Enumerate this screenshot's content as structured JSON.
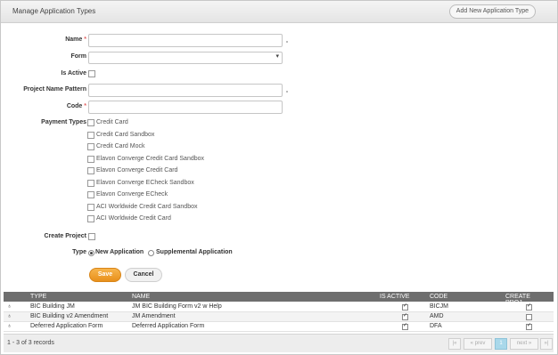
{
  "header": {
    "title": "Manage Application Types",
    "add_button": "Add New Application Type"
  },
  "form": {
    "name_label": "Name",
    "name_required": "*",
    "form_label": "Form",
    "is_active_label": "Is Active",
    "pattern_label": "Project Name Pattern",
    "code_label": "Code",
    "code_required": "*",
    "payment_types_label": "Payment Types",
    "payment_types": [
      "Credit Card",
      "Credit Card Sandbox",
      "Credit Card Mock",
      "Elavon Converge Credit Card Sandbox",
      "Elavon Converge Credit Card",
      "Elavon Converge ECheck Sandbox",
      "Elavon Converge ECheck",
      "ACI Worldwide Credit Card Sandbox",
      "ACI Worldwide Credit Card"
    ],
    "create_project_label": "Create Project",
    "type_label": "Type",
    "type_new": "New Application",
    "type_supplemental": "Supplemental Application",
    "selected_type": "New Application",
    "save": "Save",
    "cancel": "Cancel"
  },
  "grid": {
    "columns": [
      "TYPE",
      "NAME",
      "IS ACTIVE",
      "CODE",
      "CREATE PROJ..."
    ],
    "rows": [
      {
        "type": "BIC Building JM",
        "name": "JM BIC Building Form v2 w Help",
        "is_active": true,
        "code": "BICJM",
        "create_project": true
      },
      {
        "type": "BIC Building v2 Amendment",
        "name": "JM Amendment",
        "is_active": true,
        "code": "AMD",
        "create_project": false
      },
      {
        "type": "Deferred Application Form",
        "name": "Deferred Application Form",
        "is_active": true,
        "code": "DFA",
        "create_project": true
      }
    ],
    "row_icon": "bicycle-icon"
  },
  "pagination": {
    "count": "1 - 3 of 3 records",
    "first": "|«",
    "prev": "« prev",
    "page": "1",
    "next": "next »",
    "last": "»|"
  }
}
